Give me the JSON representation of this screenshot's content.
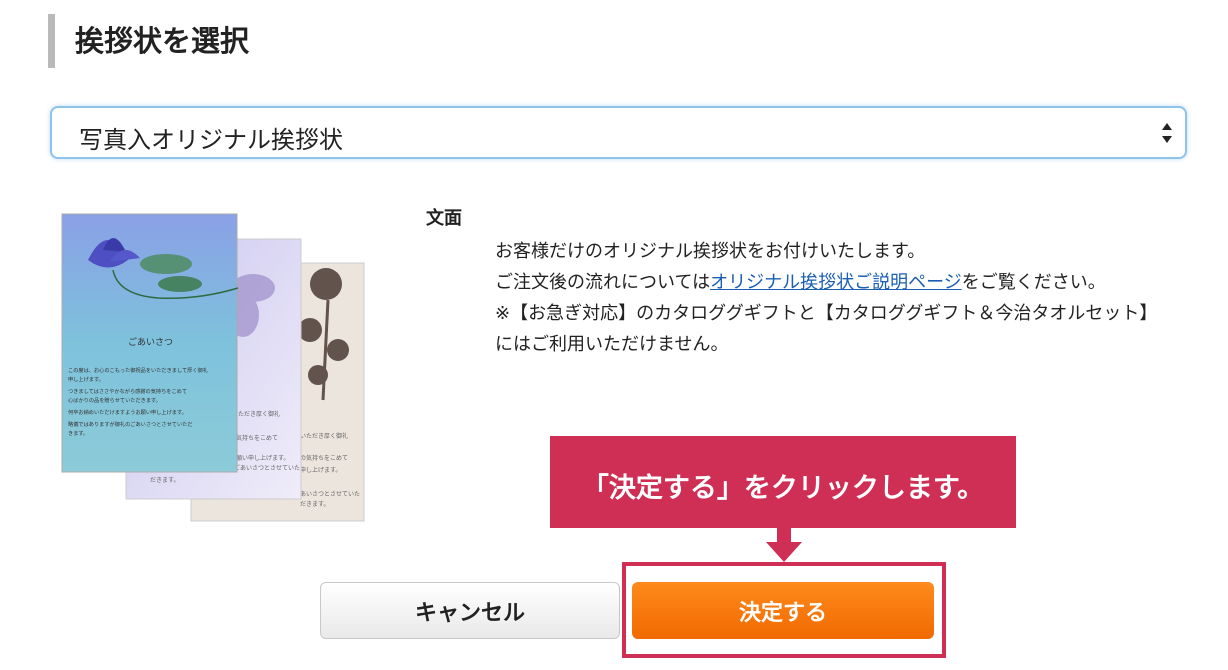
{
  "page_title": "挨拶状を選択",
  "select": {
    "value": "写真入オリジナル挨拶状"
  },
  "preview": {
    "card_title": "ごあいさつ",
    "card_lines": [
      "この度は、お心のこもった御祝品をいただきまして厚く御礼",
      "申し上げます。",
      "つきましてはささやかながら感謝の気持ちをこめて",
      "心ばかりの品を贈らせていただきます。",
      "何卒お納めいただけますようお願い申し上げます。",
      "略儀ではありますが御礼のごあいさつとさせていただ",
      "きます。"
    ],
    "card_mid_lines": [
      "いただき厚く御礼",
      "気持ちをこめて",
      "願い申し上げます。",
      "ごあいさつとさせていた",
      "だきます。"
    ],
    "card_back_lines": [
      "いただき厚く御礼",
      "の気持ちをこめて",
      "申し上げます。",
      "あいさつとさせていた",
      "だきます。"
    ]
  },
  "description": {
    "heading": "文面",
    "line1": "お客様だけのオリジナル挨拶状をお付けいたします。",
    "line2_pre": "ご注文後の流れについては",
    "line2_link": "オリジナル挨拶状ご説明ページ",
    "line2_post": "をご覧ください。",
    "line3": "※【お急ぎ対応】のカタロググギフトと【カタロググギフト＆今治タオルセット】",
    "line4": "にはご利用いただけません。"
  },
  "callout": {
    "text": "「決定する」をクリックします。",
    "color": "#d02f55"
  },
  "buttons": {
    "cancel": "キャンセル",
    "decide": "決定する",
    "decide_color": "#f47a0c"
  }
}
